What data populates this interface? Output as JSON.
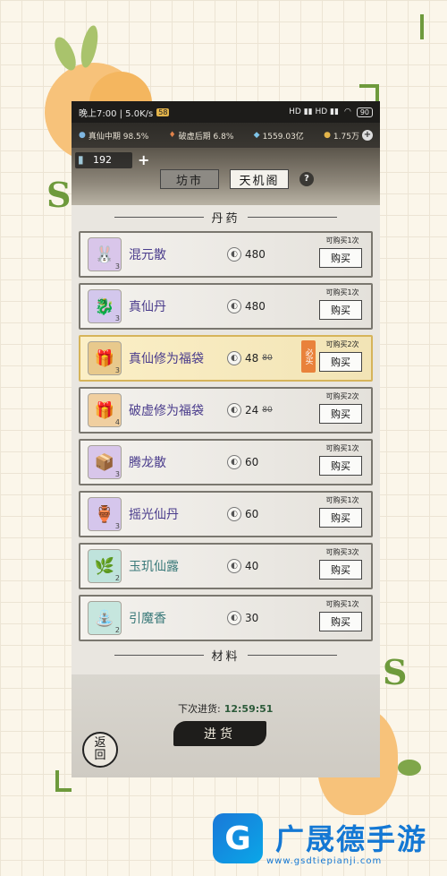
{
  "status_bar": {
    "time_speed": "晚上7:00 | 5.0K/s",
    "badge": "58",
    "signal": "HD ▮▮ HD ▮▮",
    "battery": "90"
  },
  "resources": {
    "realm1": "真仙中期 98.5%",
    "realm2": "破虚后期 6.8%",
    "spirit_stones": "1559.03亿",
    "coins": "1.75万",
    "plus": "+"
  },
  "stamina": {
    "value": "192",
    "plus": "+"
  },
  "tabs": [
    {
      "label": "坊市",
      "active": false
    },
    {
      "label": "天机阁",
      "active": true
    }
  ],
  "help": "?",
  "section_pills": "丹药",
  "section_materials": "材料",
  "items": [
    {
      "name": "混元散",
      "price": "480",
      "old_price": "",
      "limit": "可购买1次",
      "buy": "购买",
      "highlight": false,
      "must": "",
      "icon": "🐰",
      "thumb_bg": "#d9c6ea"
    },
    {
      "name": "真仙丹",
      "price": "480",
      "old_price": "",
      "limit": "可购买1次",
      "buy": "购买",
      "highlight": false,
      "must": "",
      "icon": "🐉",
      "thumb_bg": "#d3c7ec"
    },
    {
      "name": "真仙修为福袋",
      "price": "48",
      "old_price": "80",
      "limit": "可购买2次",
      "buy": "购买",
      "highlight": true,
      "must": "必买",
      "icon": "🎁",
      "thumb_bg": "#e8c98c"
    },
    {
      "name": "破虚修为福袋",
      "price": "24",
      "old_price": "80",
      "limit": "可购买2次",
      "buy": "购买",
      "highlight": false,
      "must": "",
      "icon": "🎁",
      "thumb_bg": "#f0cfa0"
    },
    {
      "name": "腾龙散",
      "price": "60",
      "old_price": "",
      "limit": "可购买1次",
      "buy": "购买",
      "highlight": false,
      "must": "",
      "icon": "📦",
      "thumb_bg": "#d8c6ea"
    },
    {
      "name": "摇光仙丹",
      "price": "60",
      "old_price": "",
      "limit": "可购买1次",
      "buy": "购买",
      "highlight": false,
      "must": "",
      "icon": "🏺",
      "thumb_bg": "#d5c6ec"
    },
    {
      "name": "玉玑仙露",
      "price": "40",
      "old_price": "",
      "limit": "可购买3次",
      "buy": "购买",
      "highlight": false,
      "must": "",
      "icon": "🌿",
      "thumb_bg": "#bfe3dc"
    },
    {
      "name": "引魔香",
      "price": "30",
      "old_price": "",
      "limit": "可购买1次",
      "buy": "购买",
      "highlight": false,
      "must": "",
      "icon": "⛲",
      "thumb_bg": "#c6e6de"
    }
  ],
  "footer": {
    "restock_label": "下次进货:",
    "restock_time": "12:59:51",
    "restock_button": "进货",
    "back_top": "返",
    "back_bottom": "回"
  },
  "watermark": {
    "title": "广晟德手游",
    "url": "www.gsdtiepianji.com"
  }
}
